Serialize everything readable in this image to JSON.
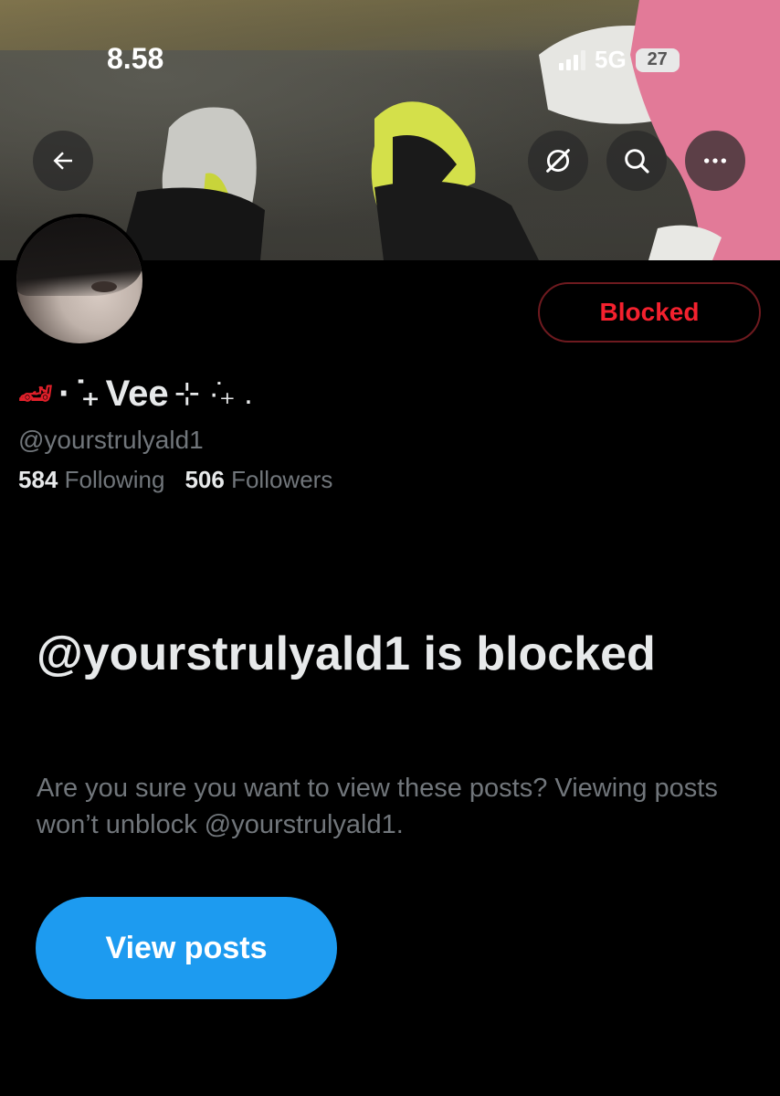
{
  "status_bar": {
    "time": "8.58",
    "network": "5G",
    "battery": "27"
  },
  "header": {
    "back_icon": "arrow-left-icon",
    "grok_icon": "grok-slash-icon",
    "search_icon": "search-icon",
    "more_icon": "more-horizontal-icon"
  },
  "profile": {
    "display_name_prefix": "· ̇₊",
    "display_name": "Vee",
    "display_name_suffix": "⊹ ·̇₊ .",
    "handle": "@yourstrulyald1",
    "following_count": "584",
    "following_label": "Following",
    "followers_count": "506",
    "followers_label": "Followers",
    "blocked_button": "Blocked"
  },
  "blocked_notice": {
    "title": "@yourstrulyald1 is blocked",
    "description": "Are you sure you want to view these posts? Viewing posts won’t unblock @yourstrulyald1.",
    "button": "View posts"
  },
  "colors": {
    "accent": "#1d9bf0",
    "blocked_red": "#f4212e",
    "text_primary": "#e7e9ea",
    "text_secondary": "#71767b"
  }
}
